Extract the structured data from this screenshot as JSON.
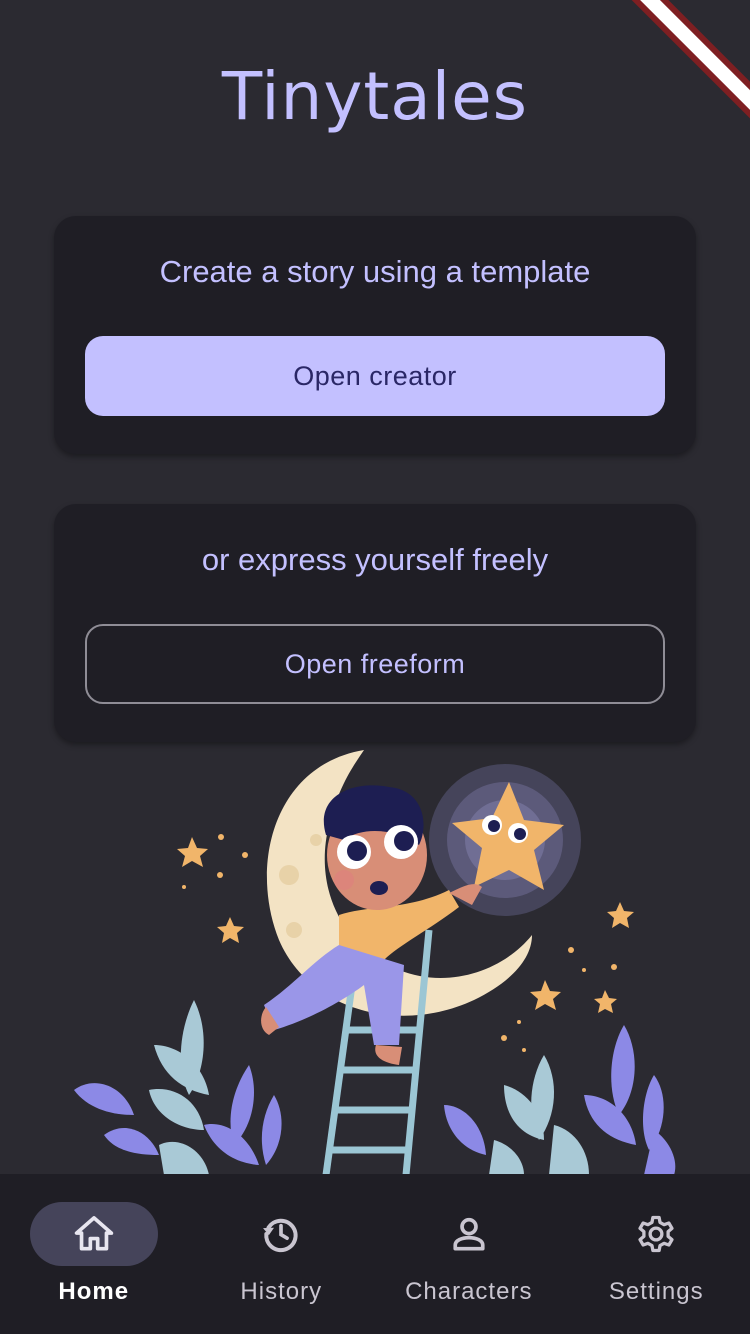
{
  "app": {
    "title": "Tinytales"
  },
  "cards": [
    {
      "heading": "Create a story using a template",
      "button_label": "Open creator"
    },
    {
      "heading": "or express yourself freely",
      "button_label": "Open freeform"
    }
  ],
  "nav": {
    "items": [
      {
        "label": "Home",
        "icon": "home-icon",
        "active": true
      },
      {
        "label": "History",
        "icon": "history-icon",
        "active": false
      },
      {
        "label": "Characters",
        "icon": "person-icon",
        "active": false
      },
      {
        "label": "Settings",
        "icon": "gear-icon",
        "active": false
      }
    ]
  },
  "colors": {
    "background": "#2b2a31",
    "surface": "#1f1e25",
    "accent": "#c3c0ff",
    "on_accent": "#2a2766",
    "nav_active_pill": "#45445a"
  }
}
